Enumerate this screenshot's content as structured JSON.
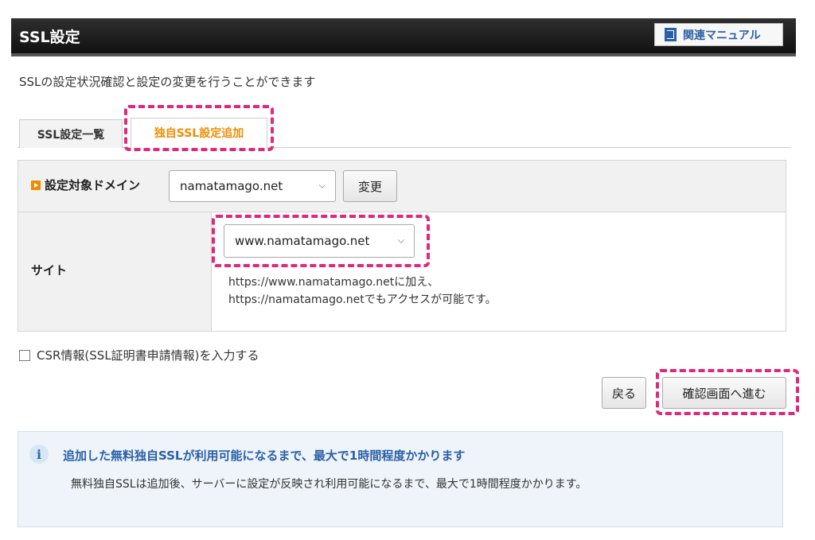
{
  "header": {
    "title": "SSL設定",
    "manual_button": "関連マニュアル"
  },
  "description": "SSLの設定状況確認と設定の変更を行うことができます",
  "tabs": [
    {
      "label": "SSL設定一覧",
      "active": false
    },
    {
      "label": "独自SSL設定追加",
      "active": true
    }
  ],
  "domain_row": {
    "label": "設定対象ドメイン",
    "selected_domain": "namatamago.net",
    "change_button": "変更"
  },
  "site_row": {
    "label": "サイト",
    "selected_site": "www.namatamago.net",
    "note_line1": "https://www.namatamago.netに加え、",
    "note_line2": "https://namatamago.netでもアクセスが可能です。"
  },
  "csr_checkbox": {
    "label": "CSR情報(SSL証明書申請情報)を入力する",
    "checked": false
  },
  "actions": {
    "back_button": "戻る",
    "confirm_button": "確認画面へ進む"
  },
  "info": {
    "icon": "info-icon",
    "title": "追加した無料独自SSLが利用可能になるまで、最大で1時間程度かかります",
    "body": "無料独自SSLは追加後、サーバーに設定が反映され利用可能になるまで、最大で1時間程度かかります。"
  },
  "colors": {
    "highlight": "#e0287a",
    "active_tab": "#f08c00",
    "link_blue": "#2a5fa8"
  }
}
